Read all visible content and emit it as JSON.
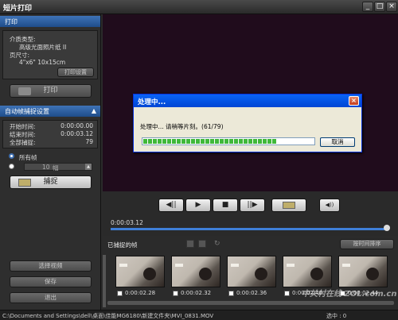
{
  "window": {
    "title": "短片打印",
    "controls": [
      "_",
      "□",
      "×"
    ]
  },
  "print_panel": {
    "header": "打印",
    "info": [
      "介质类型:",
      "高级光面照片纸 II",
      "页尺寸:",
      "4\"x6\" 10x15cm"
    ],
    "print_settings_label": "打印设置",
    "print_button_label": "打印"
  },
  "capture_panel": {
    "header": "自动帧捕捉设置",
    "collapse_glyph": "▲",
    "rows": [
      {
        "label": "开始时间:",
        "value": "0:00:00.00"
      },
      {
        "label": "结束时间:",
        "value": "0:00:03.12"
      },
      {
        "label": "全部捕捉:",
        "value": "79"
      }
    ],
    "all_frames_label": "所有帧",
    "frame_count_value": "10",
    "frame_unit": "幅",
    "capture_button_label": "捕捉"
  },
  "left_actions": {
    "select_video": "选择视频",
    "save": "保存",
    "exit": "退出"
  },
  "dialog": {
    "title": "处理中...",
    "close_glyph": "×",
    "message": "处理中... 请稍等片刻。(61/79)",
    "progress": 0.77,
    "cancel_label": "取消"
  },
  "player": {
    "time_display": "0:00:03.12",
    "buttons": {
      "prev_frame": "◀||",
      "play": "▶",
      "stop": "■",
      "next_frame": "||▶",
      "volume": "◀))"
    }
  },
  "captured": {
    "header": "已捕捉的帧",
    "sort_button": "按时间排序",
    "frames": [
      "0:00:02.28",
      "0:00:02.32",
      "0:00:02.36",
      "0:00:02.40",
      "0:00:02.44"
    ]
  },
  "statusbar": {
    "path": "C:\\Documents and Settings\\dell\\桌面\\佳能MG6180\\新建文件夹\\MVI_0831.MOV",
    "selected": "选中 : 0"
  },
  "watermark": "中关村在线 ZOL.com.cn"
}
